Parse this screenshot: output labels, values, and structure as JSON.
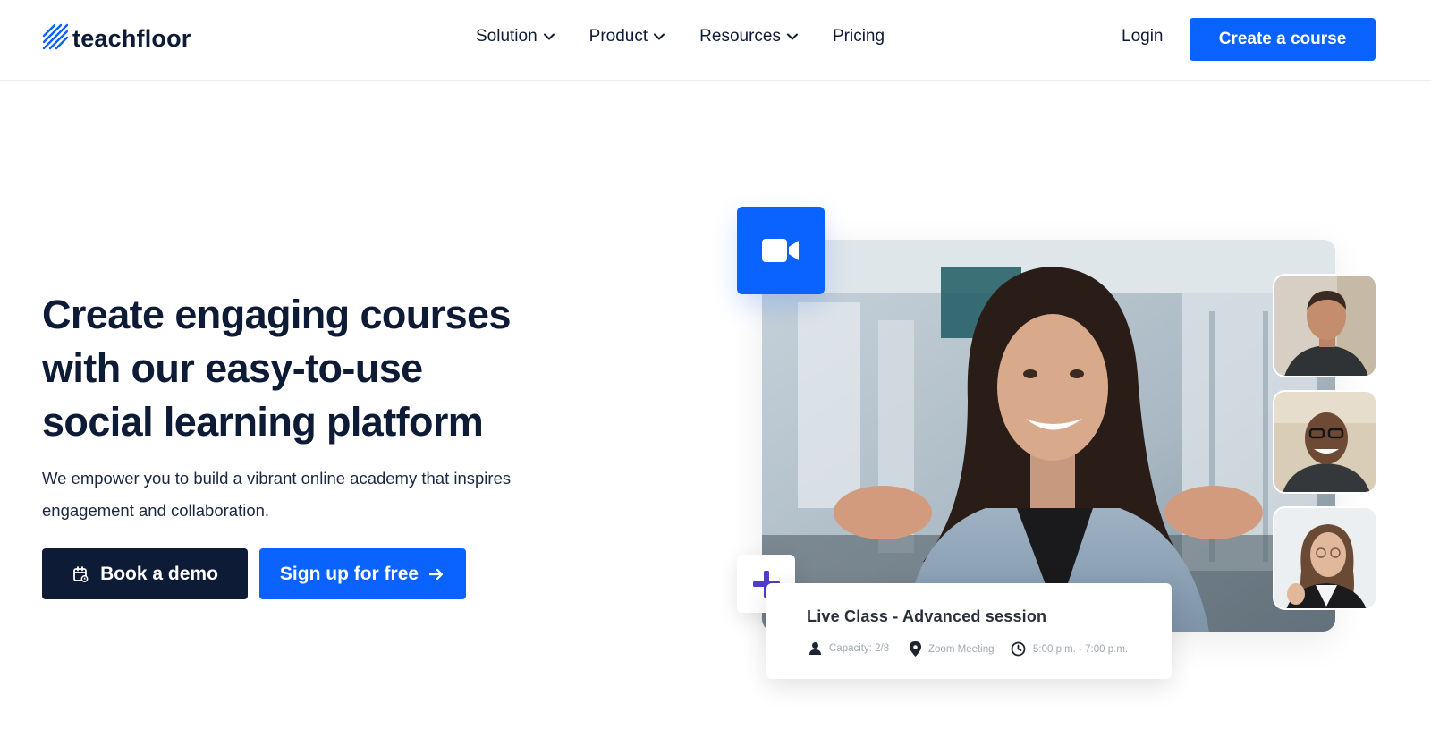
{
  "brand": {
    "name": "teachfloor",
    "accent": "#0a63ff",
    "dark": "#0d1b36"
  },
  "nav": {
    "items": [
      {
        "label": "Solution",
        "has_dropdown": true
      },
      {
        "label": "Product",
        "has_dropdown": true
      },
      {
        "label": "Resources",
        "has_dropdown": true
      },
      {
        "label": "Pricing",
        "has_dropdown": false
      }
    ],
    "login_label": "Login",
    "cta_label": "Create a course"
  },
  "hero": {
    "title_lines": [
      "Create engaging courses",
      "with our easy-to-use",
      "social learning platform"
    ],
    "subtitle_lines": [
      "We empower you to build a vibrant online academy that inspires",
      "engagement and collaboration."
    ],
    "demo_button": "Book a demo",
    "signup_button": "Sign up for free"
  },
  "live_class": {
    "title": "Live Class - Advanced session",
    "capacity": "Capacity: 2/8",
    "location": "Zoom Meeting",
    "time": "5:00 p.m. - 7:00 p.m."
  },
  "icons": {
    "video_tile": "video-camera-icon",
    "plus_tile": "plus-icon",
    "calendar": "calendar-icon",
    "arrow": "arrow-right-icon"
  }
}
